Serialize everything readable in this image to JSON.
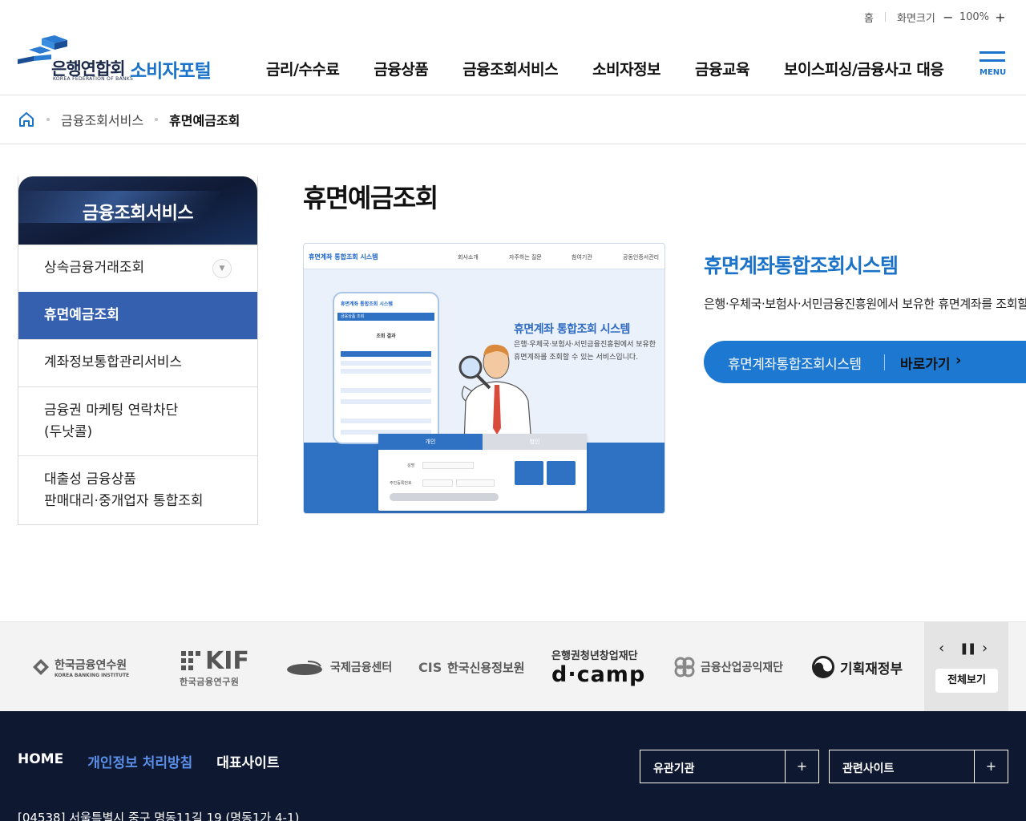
{
  "util": {
    "home": "홈",
    "screen_size_label": "화면크기",
    "zoom_minus": "−",
    "zoom_value": "100%",
    "zoom_plus": "+"
  },
  "logo": {
    "org": "은행연합회",
    "org_en": "KOREA FEDERATION OF BANKS",
    "portal": "소비자포털"
  },
  "gnb": [
    {
      "label": "금리/수수료"
    },
    {
      "label": "금융상품"
    },
    {
      "label": "금융조회서비스"
    },
    {
      "label": "소비자정보"
    },
    {
      "label": "금융교육"
    },
    {
      "label": "보이스피싱/금융사고 대응"
    }
  ],
  "menu_label": "MENU",
  "breadcrumb": {
    "level1": "금융조회서비스",
    "current": "휴면예금조회"
  },
  "lnb": {
    "title": "금융조회서비스",
    "items": [
      {
        "label": "상속금융거래조회"
      },
      {
        "label": "휴면예금조회"
      },
      {
        "label": "계좌정보통합관리서비스"
      },
      {
        "line1": "금융권 마케팅 연락차단",
        "line2": "(두낫콜)"
      },
      {
        "line1": "대출성 금융상품",
        "line2": "판매대리·중개업자 통합조회"
      }
    ]
  },
  "page_title": "휴면예금조회",
  "thumbnail": {
    "site_title": "휴면계좌 통합조회 시스템",
    "nav": [
      "회사소개",
      "자주하는 질문",
      "참여기관",
      "공동인증서관리"
    ],
    "phone_title": "휴면계좌 통합조회 시스템",
    "phone_bar": "금융상품 조회",
    "phone_result": "조회 결과",
    "headline": "휴면계좌 통합조회 시스템",
    "desc": "은행·우체국·보험사·서민금융진흥원에서 보유한 휴면계좌를 조회할 수 있는 서비스입니다.",
    "tab_personal": "개인",
    "tab_corporate": "법인",
    "field_name": "성명",
    "field_id": "주민등록번호"
  },
  "system": {
    "title": "휴면계좌통합조회시스템",
    "desc": "은행·우체국·보험사·서민금융진흥원에서 보유한 휴면계좌를 조회할",
    "button_label": "휴면계좌통합조회시스템",
    "button_go": "바로가기"
  },
  "partners": {
    "p1": "한국금융연수원",
    "p1_en": "KOREA BANKING INSTITUTE",
    "p2": "KIF",
    "p2_sub": "한국금융연구원",
    "p3": "국제금융센터",
    "p4": "한국신용정보원",
    "p5_top": "은행권청년창업재단",
    "p5": "d·camp",
    "p6": "금융산업공익재단",
    "p7": "기획재정부",
    "view_all": "전체보기"
  },
  "footer": {
    "home": "HOME",
    "privacy": "개인정보 처리방침",
    "main_site": "대표사이트",
    "related_orgs": "유관기관",
    "related_sites": "관련사이트",
    "address": "[04538] 서울특별시 중구 명동11길 19 (명동1가 4-1)"
  }
}
